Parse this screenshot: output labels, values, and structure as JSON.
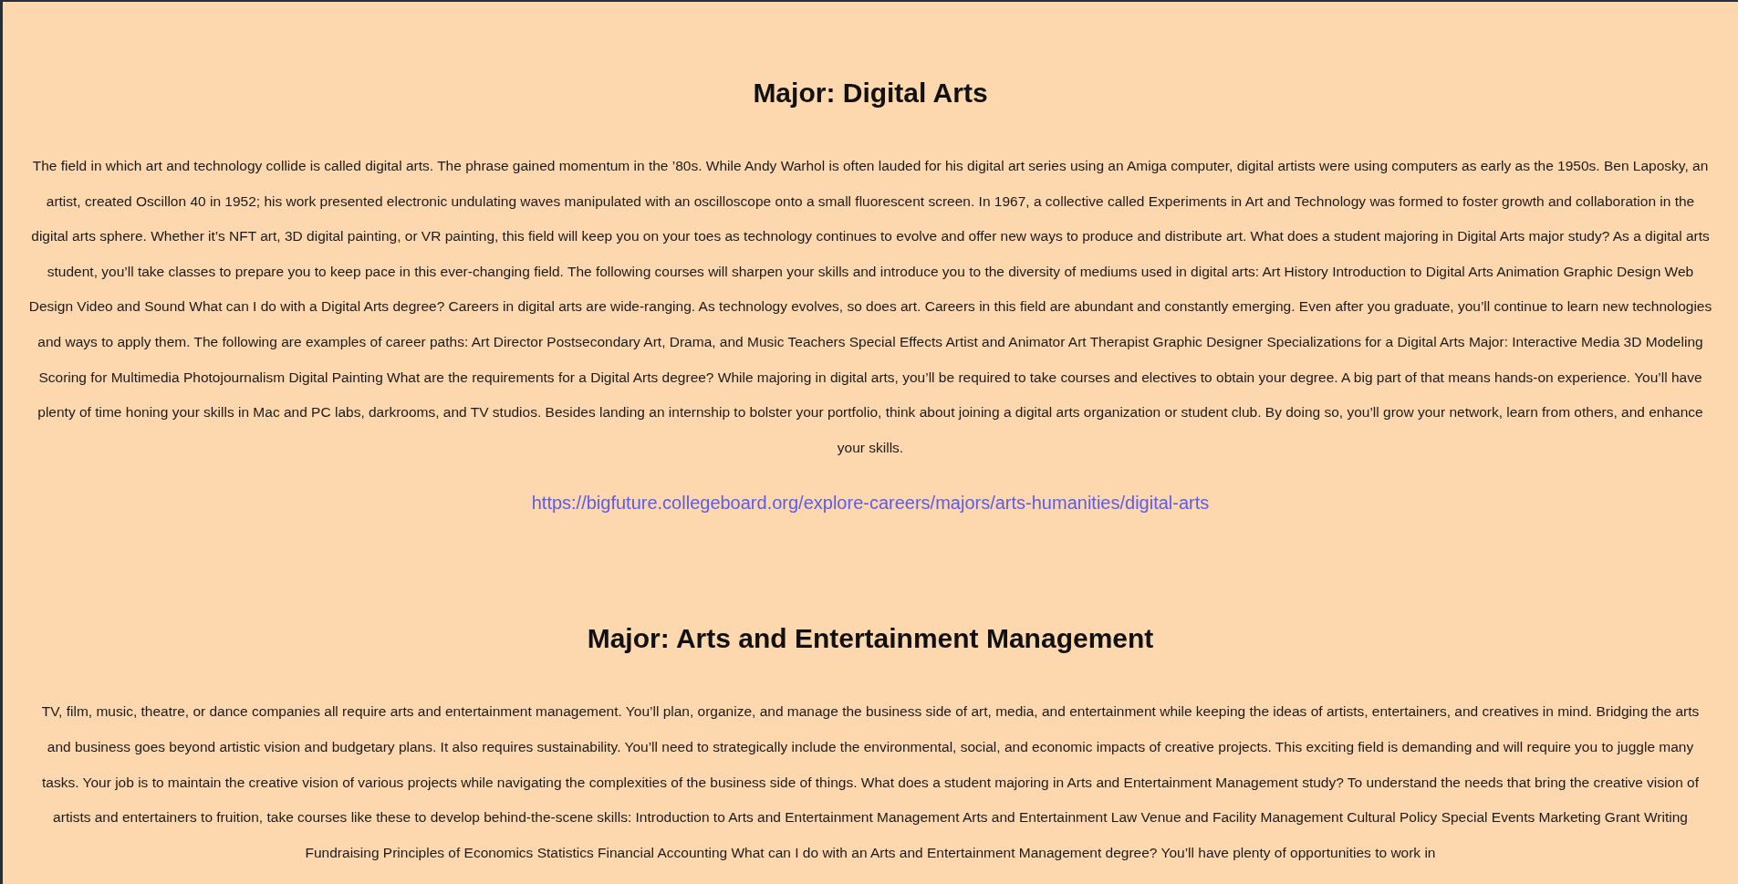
{
  "sections": [
    {
      "heading": "Major: Digital Arts",
      "text": "The field in which art and technology collide is called digital arts. The phrase gained momentum in the ’80s. While Andy Warhol is often lauded for his digital art series using an Amiga computer, digital artists were using computers as early as the 1950s. Ben Laposky, an artist, created Oscillon 40 in 1952; his work presented electronic undulating waves manipulated with an oscilloscope onto a small fluorescent screen. In 1967, a collective called Experiments in Art and Technology was formed to foster growth and collaboration in the digital arts sphere.  Whether it’s NFT art, 3D digital painting, or VR painting, this field will keep you on your toes as technology continues to evolve and offer new ways to produce and distribute art.  What does a student majoring in Digital Arts major study?  As a digital arts student, you’ll take classes to prepare you to keep pace in this ever-changing field. The following courses will sharpen your skills and introduce you to the diversity of mediums used in digital arts: Art History Introduction to Digital Arts Animation Graphic Design Web Design Video and Sound What can I do with a Digital Arts degree? Careers in digital arts are wide-ranging. As technology evolves, so does art. Careers in this field are abundant and constantly emerging. Even after you graduate, you’ll continue to learn new technologies and ways to apply them. The following are examples of career paths: Art Director Postsecondary Art, Drama, and Music Teachers Special Effects Artist and Animator Art Therapist Graphic Designer Specializations for a Digital Arts Major: Interactive Media 3D Modeling Scoring for Multimedia Photojournalism Digital Painting What are the requirements for a Digital Arts degree?  While majoring in digital arts, you’ll be required to take courses and electives to obtain your degree. A big part of that means hands-on experience. You’ll have plenty of time honing your skills in Mac and PC labs, darkrooms, and TV studios. Besides landing an internship to bolster your portfolio, think about joining a digital arts organization or student club. By doing so, you’ll grow your network, learn from others, and enhance your skills.",
      "link": "https://bigfuture.collegeboard.org/explore-careers/majors/arts-humanities/digital-arts"
    },
    {
      "heading": "Major: Arts and Entertainment Management",
      "text": "TV, film, music, theatre, or dance companies all require arts and entertainment management.  You’ll plan, organize, and manage the business side of art, media, and entertainment while keeping the ideas of artists, entertainers, and creatives in mind. Bridging the arts and business goes beyond artistic vision and budgetary plans. It also requires sustainability. You’ll need to strategically include the environmental, social, and economic impacts of creative projects. This exciting field is demanding and will require you to juggle many tasks. Your job is to maintain the creative vision of various projects while navigating the complexities of the business side of things.  What does a student majoring in Arts and Entertainment Management study?  To understand the needs that bring the creative vision of artists and entertainers to fruition, take courses like these to develop behind-the-scene skills: Introduction to Arts and Entertainment Management Arts and Entertainment Law Venue and Facility Management Cultural Policy Special Events Marketing  Grant Writing Fundraising Principles of Economics Statistics Financial Accounting What can I do with an Arts and Entertainment Management degree? You’ll have plenty of opportunities to work in"
    }
  ]
}
